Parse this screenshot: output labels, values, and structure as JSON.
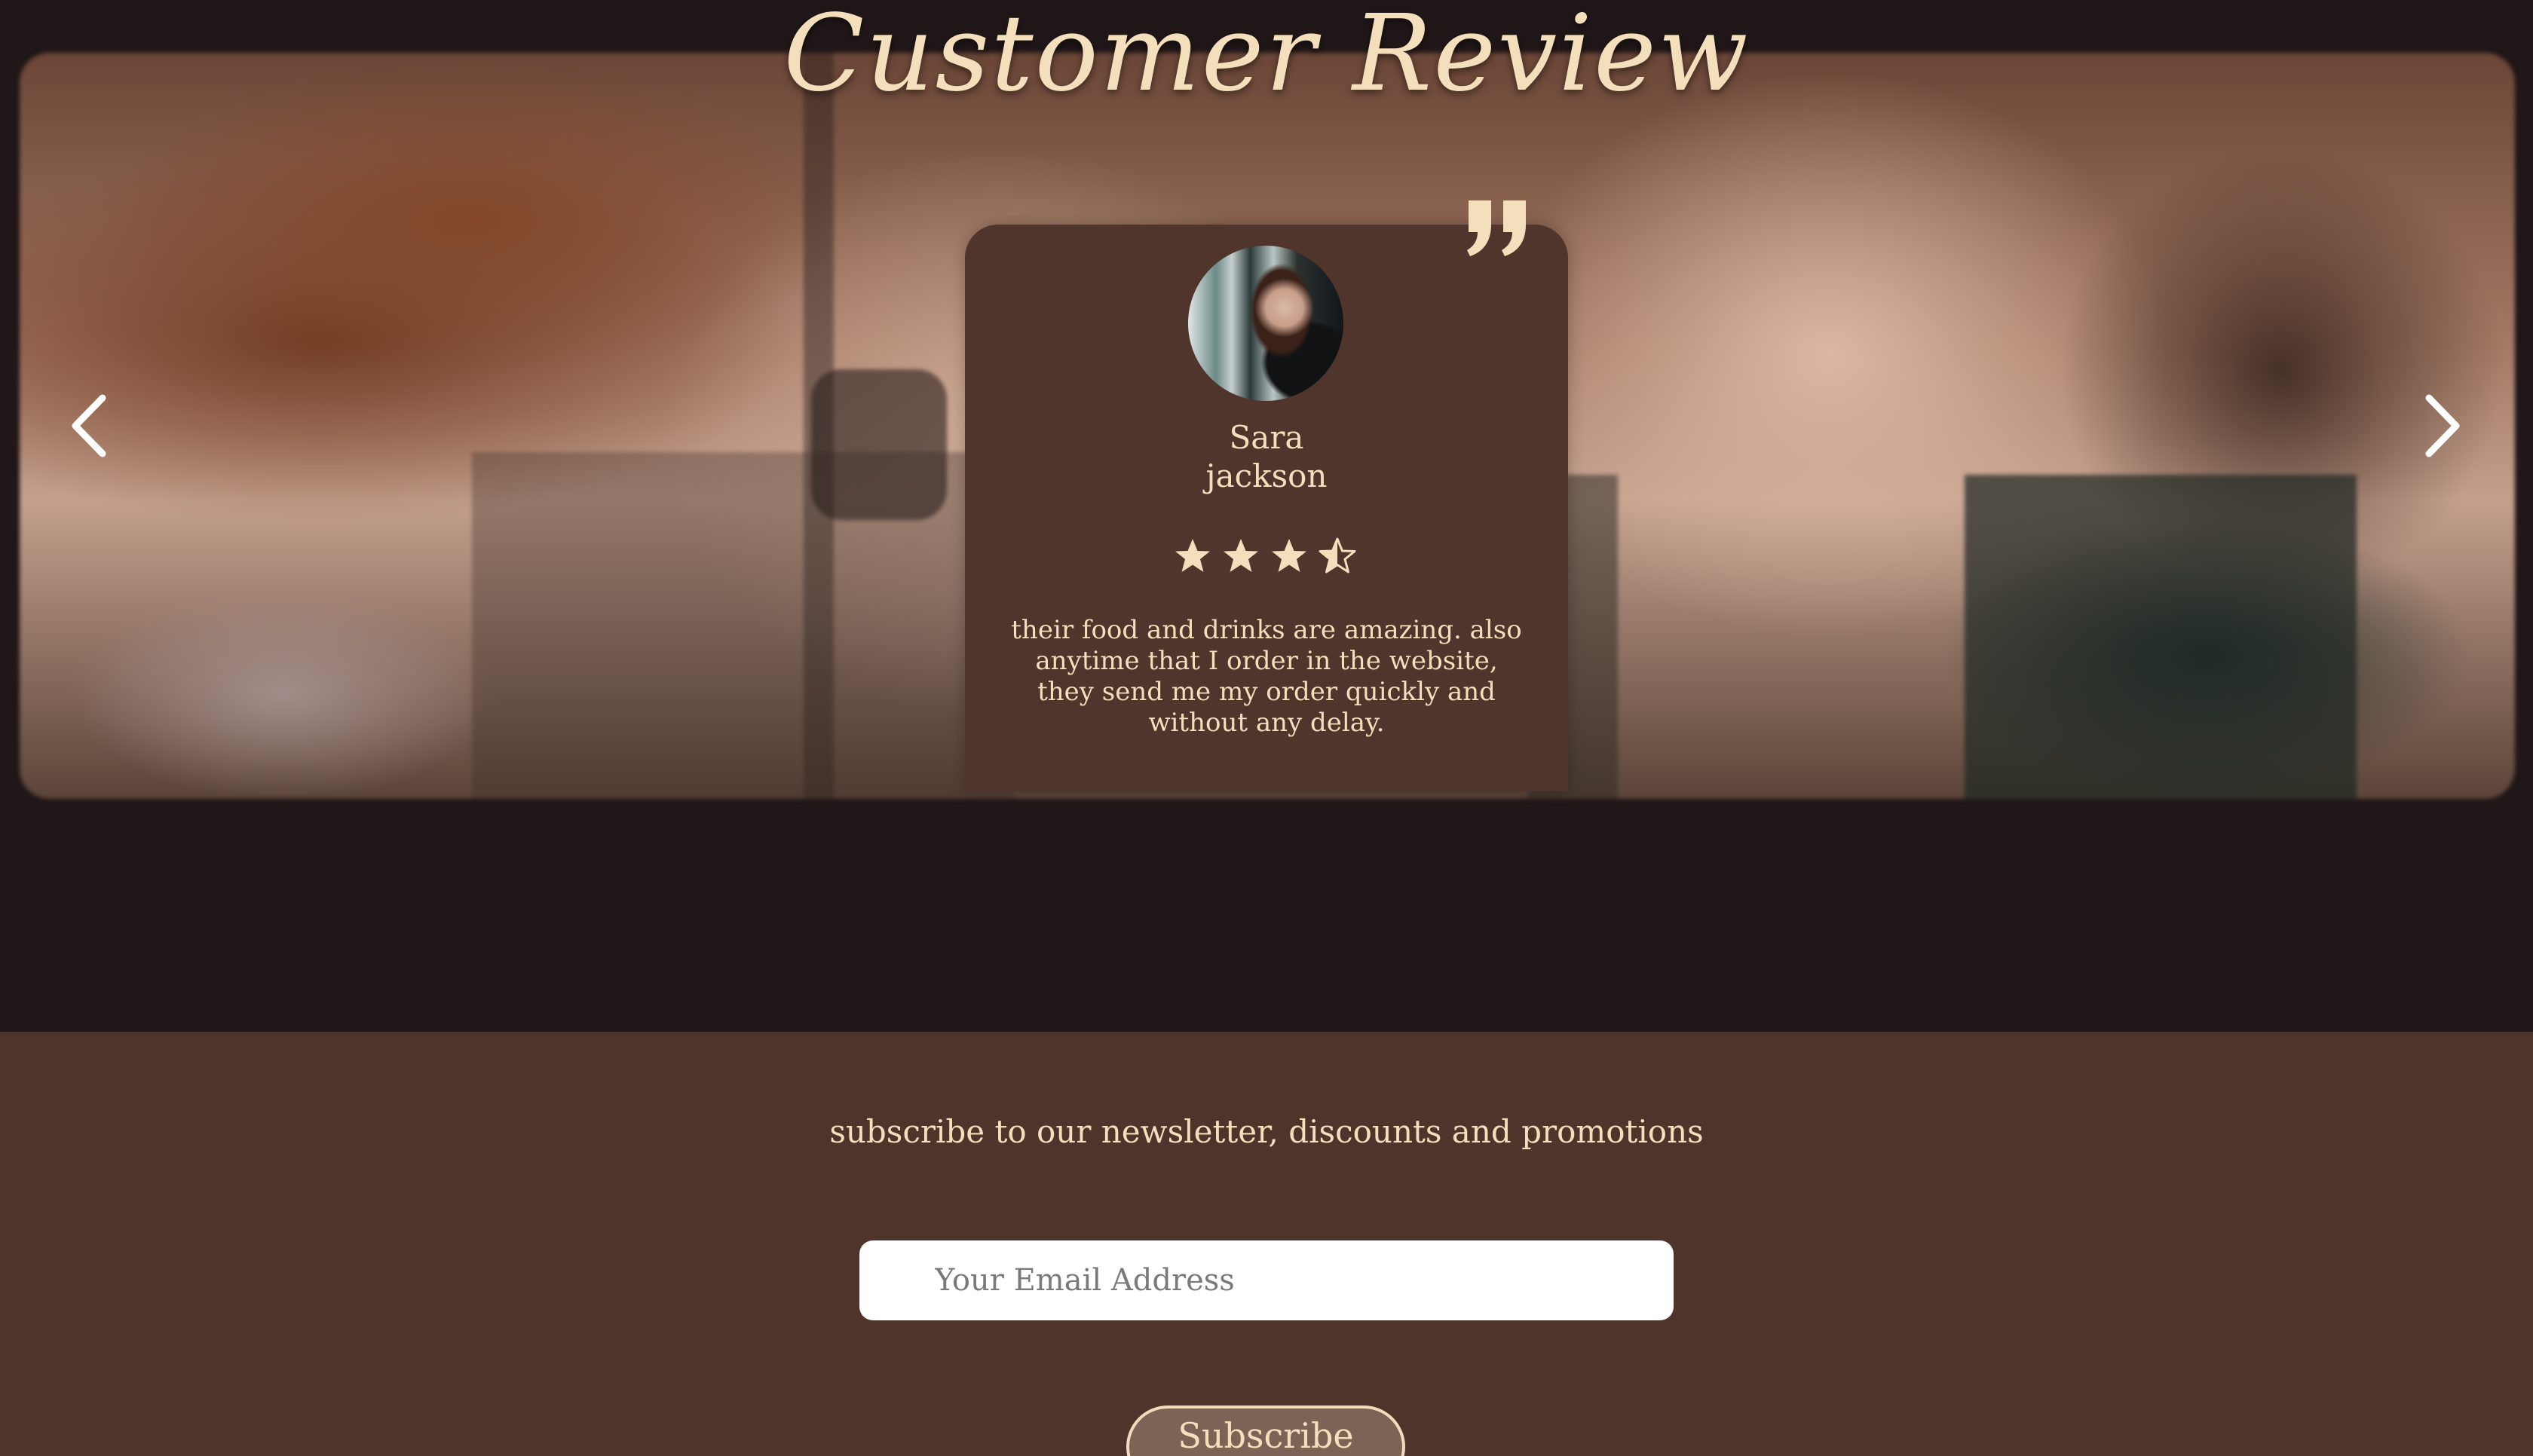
{
  "review_section": {
    "title": "Customer Review",
    "reviewer": {
      "first_name": "Sara",
      "last_name": "jackson"
    },
    "rating": 3.5,
    "rating_max": 4,
    "review_text": "their food and drinks are amazing. also anytime that I order in the website, they send me my order quickly and without any delay.",
    "icons": {
      "prev": "chevron-left-icon",
      "next": "chevron-right-icon",
      "quote": "quote-icon",
      "star": "star-icon"
    }
  },
  "newsletter": {
    "heading": "subscribe to our newsletter, discounts and promotions",
    "email_placeholder": "Your Email Address",
    "subscribe_label": "Subscribe"
  },
  "colors": {
    "page_dark": "#201718",
    "card": "#4f352b",
    "accent_text": "#f4dfbd",
    "newsletter_bg": "#4e342b",
    "button_bg": "#7c6356"
  }
}
